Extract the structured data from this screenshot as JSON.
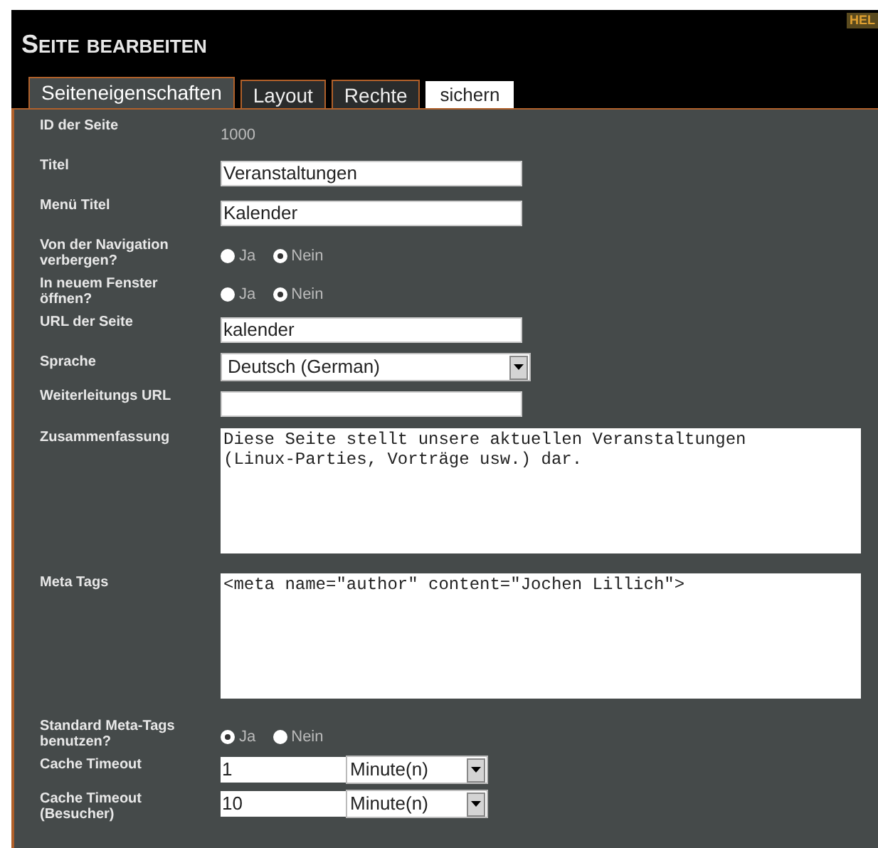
{
  "corner_label": "HEL",
  "title": "Seite bearbeiten",
  "tabs": [
    {
      "label": "Seiteneigenschaften",
      "selected": true,
      "kind": "tab"
    },
    {
      "label": "Layout",
      "selected": false,
      "kind": "tab"
    },
    {
      "label": "Rechte",
      "selected": false,
      "kind": "tab"
    },
    {
      "label": "sichern",
      "kind": "button"
    }
  ],
  "rows": [
    {
      "kind": "static",
      "label": "ID der Seite",
      "value": "1000"
    },
    {
      "kind": "text",
      "label": "Titel",
      "value": "Veranstaltungen"
    },
    {
      "kind": "text",
      "label": "Menü Titel",
      "value": "Kalender"
    },
    {
      "kind": "radio",
      "label": "Von der Navigation verbergen?",
      "options": [
        {
          "label": "Ja",
          "selected": false
        },
        {
          "label": "Nein",
          "selected": true
        }
      ]
    },
    {
      "kind": "radio",
      "label": "In neuem Fenster öffnen?",
      "options": [
        {
          "label": "Ja",
          "selected": false
        },
        {
          "label": "Nein",
          "selected": true
        }
      ]
    },
    {
      "kind": "text",
      "label": "URL der Seite",
      "value": "kalender"
    },
    {
      "kind": "select",
      "label": "Sprache",
      "value": "Deutsch (German)"
    },
    {
      "kind": "text",
      "label": "Weiterleitungs URL"
    },
    {
      "kind": "textarea",
      "label": "Zusammenfassung",
      "value": "Diese Seite stellt unsere aktuellen Veranstaltungen\n(Linux-Parties, Vorträge usw.) dar."
    },
    {
      "kind": "textarea",
      "label": "Meta Tags",
      "value": "<meta name=\"author\" content=\"Jochen Lillich\">"
    },
    {
      "kind": "radio",
      "label": "Standard Meta-Tags benutzen?",
      "options": [
        {
          "label": "Ja",
          "selected": true
        },
        {
          "label": "Nein",
          "selected": false
        }
      ]
    },
    {
      "kind": "combo",
      "label": "Cache Timeout",
      "value": "1",
      "unit": "Minute(n)"
    },
    {
      "kind": "combo",
      "label": "Cache Timeout (Besucher)",
      "value": "10",
      "unit": "Minute(n)"
    }
  ]
}
